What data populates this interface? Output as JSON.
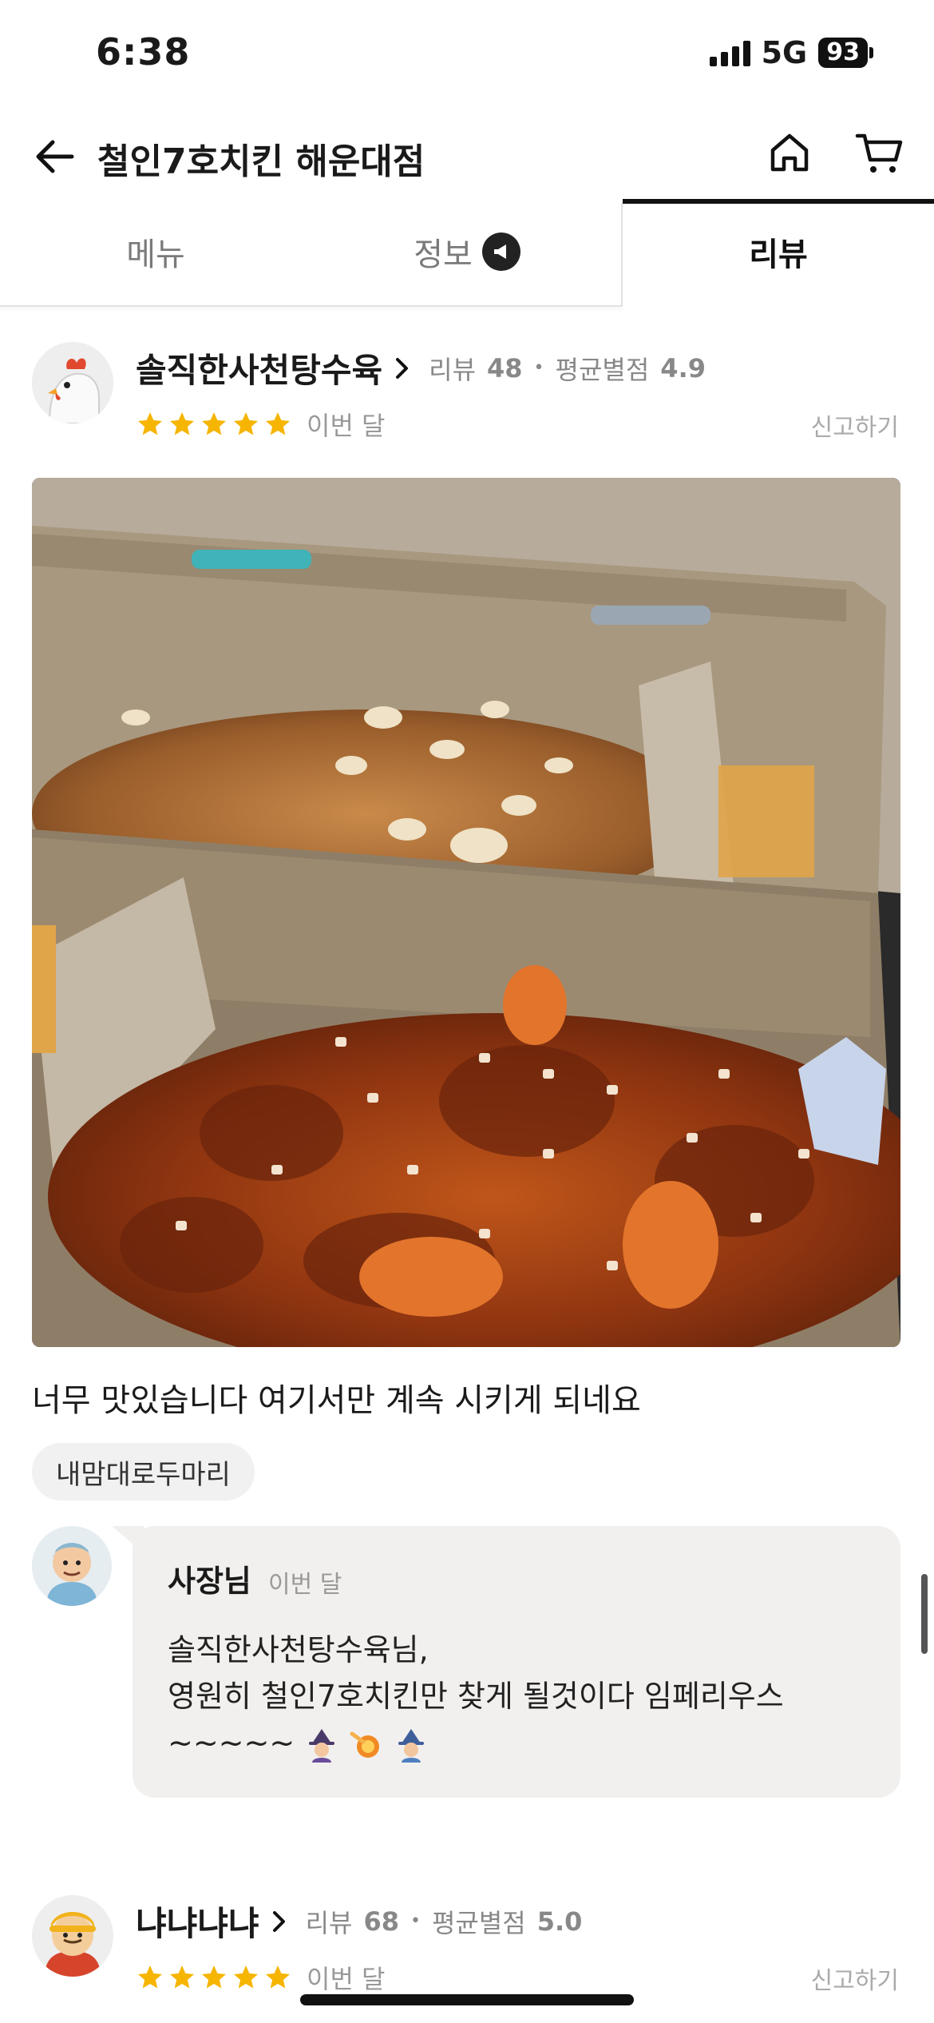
{
  "status_bar": {
    "time": "6:38",
    "network": "5G",
    "battery": "93"
  },
  "header": {
    "title": "철인7호치킨 해운대점"
  },
  "tabs": [
    {
      "label": "메뉴"
    },
    {
      "label": "정보"
    },
    {
      "label": "리뷰",
      "active": true
    }
  ],
  "reviews": [
    {
      "name": "솔직한사천탕수육",
      "review_label": "리뷰",
      "review_count": "48",
      "rating_label": "평균별점",
      "avg_rating": "4.9",
      "stars": 5,
      "when": "이번 달",
      "report": "신고하기",
      "text": "너무 맛있습니다 여기서만 계속 시키게 되네요",
      "tag": "내맘대로두마리",
      "reply": {
        "author": "사장님",
        "when": "이번 달",
        "line1": "솔직한사천탕수육님,",
        "line2": "영원히 철인7호치킨만 찾게 될것이다 임페리우스",
        "line3": "~~~~~"
      }
    },
    {
      "name": "냐냐냐냐",
      "review_label": "리뷰",
      "review_count": "68",
      "rating_label": "평균별점",
      "avg_rating": "5.0",
      "stars": 5,
      "when": "이번 달",
      "report": "신고하기"
    }
  ],
  "colors": {
    "star": "#f6b500",
    "active_tab": "#111111",
    "reply_bg": "#f2f0ee"
  }
}
